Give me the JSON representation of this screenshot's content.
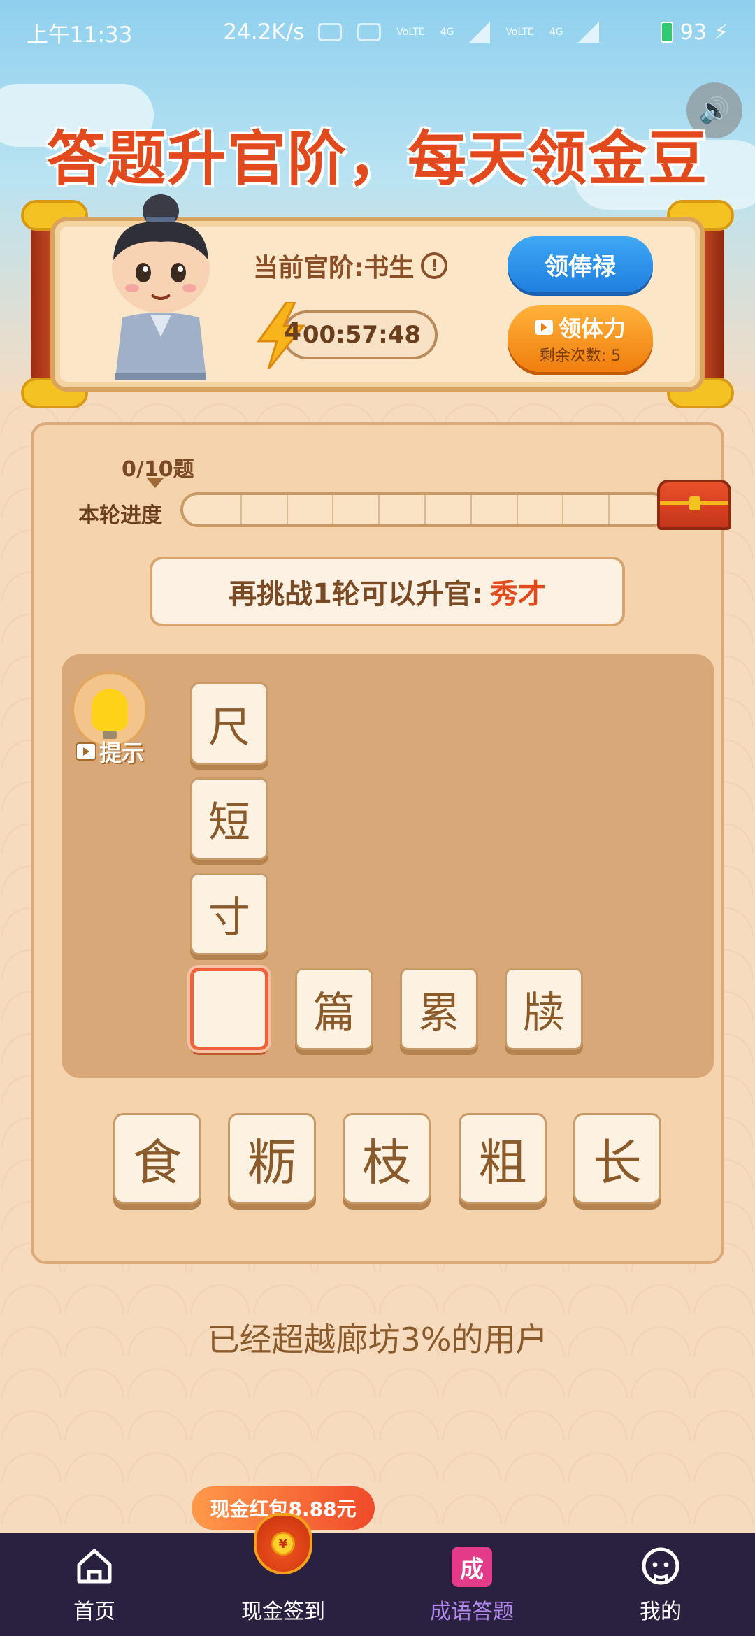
{
  "status_bar": {
    "time": "上午11:33",
    "net_speed": "24.2K/s",
    "signal_labels": [
      "VoLTE",
      "4G",
      "VoLTE",
      "4G"
    ],
    "battery": "93"
  },
  "header": {
    "headline": "答题升官阶，每天领金豆"
  },
  "profile": {
    "rank_label": "当前官阶:书生",
    "energy_count": "4",
    "timer": "00:57:48",
    "salary_button": "领俸禄",
    "energy_button": "领体力",
    "energy_remaining": "剩余次数: 5"
  },
  "progress": {
    "count": "0/10题",
    "label": "本轮进度",
    "value": 0,
    "segments": 10
  },
  "challenge": {
    "prefix": "再挑战1轮可以升官:",
    "target_rank": "秀才"
  },
  "puzzle": {
    "hint_label": "提示",
    "vertical_chars": [
      "尺",
      "短",
      "寸"
    ],
    "row_chars": [
      "",
      "篇",
      "累",
      "牍"
    ]
  },
  "choices": [
    "食",
    "粝",
    "枝",
    "粗",
    "长"
  ],
  "ranking_text": "已经超越廊坊3%的用户",
  "promo": {
    "red_packet": "现金红包8.88元"
  },
  "bottom_nav": [
    {
      "label": "首页",
      "icon": "home-icon"
    },
    {
      "label": "现金签到",
      "icon": "cash-bag-icon"
    },
    {
      "label": "成语答题",
      "icon": "idiom-icon",
      "active": true,
      "badge": "成"
    },
    {
      "label": "我的",
      "icon": "profile-icon"
    }
  ],
  "colors": {
    "accent_red": "#e24a1d",
    "nav_bg": "#2a2140",
    "nav_active": "#b289f0",
    "button_blue": "#1f7fe0",
    "button_orange": "#f07e0e"
  }
}
